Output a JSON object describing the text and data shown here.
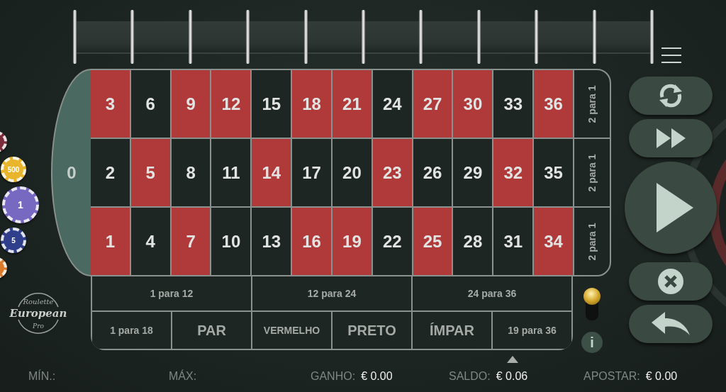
{
  "chips": [
    {
      "kind": "partial",
      "color": "#7c2b3b",
      "selected": false
    },
    {
      "kind": "full",
      "label": "500",
      "color": "#e9b52c",
      "selected": false
    },
    {
      "kind": "full",
      "label": "1",
      "color": "#7768c2",
      "selected": true
    },
    {
      "kind": "full",
      "label": "5",
      "color": "#2f3f8c",
      "selected": false
    },
    {
      "kind": "partial",
      "color": "#dc7a2c",
      "selected": false
    }
  ],
  "logo": {
    "top": "Roulette",
    "main": "European",
    "bottom": "Pro"
  },
  "zero": {
    "label": "0"
  },
  "numbers": [
    [
      {
        "label": "3",
        "color": "#b03a3a"
      },
      {
        "label": "6",
        "color": "#1d2622"
      },
      {
        "label": "9",
        "color": "#b03a3a"
      },
      {
        "label": "12",
        "color": "#b03a3a"
      },
      {
        "label": "15",
        "color": "#1d2622"
      },
      {
        "label": "18",
        "color": "#b03a3a"
      },
      {
        "label": "21",
        "color": "#b03a3a"
      },
      {
        "label": "24",
        "color": "#1d2622"
      },
      {
        "label": "27",
        "color": "#b03a3a"
      },
      {
        "label": "30",
        "color": "#b03a3a"
      },
      {
        "label": "33",
        "color": "#1d2622"
      },
      {
        "label": "36",
        "color": "#b03a3a"
      }
    ],
    [
      {
        "label": "2",
        "color": "#1d2622"
      },
      {
        "label": "5",
        "color": "#b03a3a"
      },
      {
        "label": "8",
        "color": "#1d2622"
      },
      {
        "label": "11",
        "color": "#1d2622"
      },
      {
        "label": "14",
        "color": "#b03a3a"
      },
      {
        "label": "17",
        "color": "#1d2622"
      },
      {
        "label": "20",
        "color": "#1d2622"
      },
      {
        "label": "23",
        "color": "#b03a3a"
      },
      {
        "label": "26",
        "color": "#1d2622"
      },
      {
        "label": "29",
        "color": "#1d2622"
      },
      {
        "label": "32",
        "color": "#b03a3a"
      },
      {
        "label": "35",
        "color": "#1d2622"
      }
    ],
    [
      {
        "label": "1",
        "color": "#b03a3a"
      },
      {
        "label": "4",
        "color": "#1d2622"
      },
      {
        "label": "7",
        "color": "#b03a3a"
      },
      {
        "label": "10",
        "color": "#1d2622"
      },
      {
        "label": "13",
        "color": "#1d2622"
      },
      {
        "label": "16",
        "color": "#b03a3a"
      },
      {
        "label": "19",
        "color": "#b03a3a"
      },
      {
        "label": "22",
        "color": "#1d2622"
      },
      {
        "label": "25",
        "color": "#b03a3a"
      },
      {
        "label": "28",
        "color": "#1d2622"
      },
      {
        "label": "31",
        "color": "#1d2622"
      },
      {
        "label": "34",
        "color": "#b03a3a"
      }
    ]
  ],
  "column_bets": [
    "2 para 1",
    "2 para 1",
    "2 para 1"
  ],
  "dozens": [
    "1 para 12",
    "12 para 24",
    "24 para 36"
  ],
  "outside_bets": [
    {
      "label": "1 para 18",
      "kind": "small"
    },
    {
      "label": "PAR",
      "kind": "large"
    },
    {
      "label": "VERMELHO",
      "kind": "small"
    },
    {
      "label": "PRETO",
      "kind": "large"
    },
    {
      "label": "ÍMPAR",
      "kind": "large"
    },
    {
      "label": "19 para 36",
      "kind": "small"
    }
  ],
  "info": {
    "label": "i"
  },
  "controls": [
    {
      "kind": "rebet"
    },
    {
      "kind": "double"
    },
    {
      "kind": "spin"
    },
    {
      "kind": "clear"
    },
    {
      "kind": "undo"
    }
  ],
  "footer": [
    {
      "label": "MÍN.:",
      "caret": false
    },
    {
      "label": "MÁX:",
      "caret": false
    },
    {
      "label": "GANHO:",
      "value": "€ 0.00",
      "caret": false
    },
    {
      "label": "SALDO:",
      "value": "€ 0.06",
      "caret": true
    },
    {
      "label": "APOSTAR:",
      "value": "€ 0.00",
      "caret": false
    }
  ]
}
